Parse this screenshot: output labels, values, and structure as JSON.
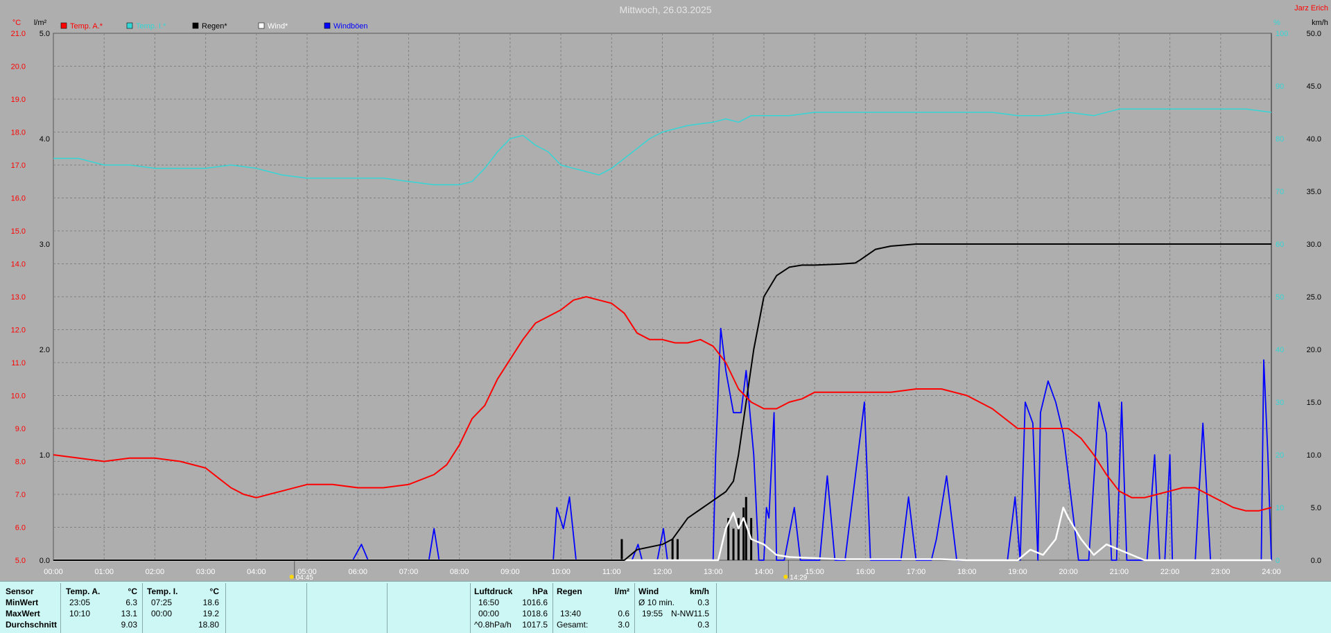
{
  "title": "Mittwoch, 26.03.2025",
  "station": "Jarz Erich",
  "colors": {
    "temp_a": "#ff0000",
    "temp_i": "#33d6d6",
    "regen": "#000000",
    "wind": "#ffffff",
    "windboeen": "#0000ff",
    "bg": "#aeaeae",
    "panel": "#ccf7f4"
  },
  "axes": {
    "temp_unit": "°C",
    "rain_unit": "l/m²",
    "humidity_unit": "%",
    "wind_unit": "km/h",
    "temp_ticks": [
      "5.0",
      "6.0",
      "7.0",
      "8.0",
      "9.0",
      "10.0",
      "11.0",
      "12.0",
      "13.0",
      "14.0",
      "15.0",
      "16.0",
      "17.0",
      "18.0",
      "19.0",
      "20.0",
      "21.0"
    ],
    "rain_ticks": [
      "0.0",
      "1.0",
      "2.0",
      "3.0",
      "4.0",
      "5.0"
    ],
    "humidity_ticks": [
      "0",
      "10",
      "20",
      "30",
      "40",
      "50",
      "60",
      "70",
      "80",
      "90",
      "100"
    ],
    "wind_ticks": [
      "0.0",
      "5.0",
      "10.0",
      "15.0",
      "20.0",
      "25.0",
      "30.0",
      "35.0",
      "40.0",
      "45.0",
      "50.0"
    ],
    "x_ticks": [
      "00:00",
      "01:00",
      "02:00",
      "03:00",
      "04:00",
      "05:00",
      "06:00",
      "07:00",
      "08:00",
      "09:00",
      "10:00",
      "11:00",
      "12:00",
      "13:00",
      "14:00",
      "15:00",
      "16:00",
      "17:00",
      "18:00",
      "19:00",
      "20:00",
      "21:00",
      "22:00",
      "23:00",
      "24:00"
    ],
    "sunrise": "04:45",
    "sunset": "14:29"
  },
  "legend": [
    {
      "label": "Temp. A.*",
      "color": "#ff0000"
    },
    {
      "label": "Temp. I.*",
      "color": "#33d6d6"
    },
    {
      "label": "Regen*",
      "color": "#000000"
    },
    {
      "label": "Wind*",
      "color": "#ffffff"
    },
    {
      "label": "Windböen",
      "color": "#0000ff"
    }
  ],
  "chart_data": {
    "type": "line",
    "title": "Mittwoch, 26.03.2025",
    "xlim": [
      0,
      24
    ],
    "ylim_temp": [
      5,
      21
    ],
    "ylim_rain": [
      0,
      5
    ],
    "ylim_wind": [
      0,
      50
    ],
    "series": [
      {
        "name": "Temp. A.*",
        "axis": "temp",
        "x": [
          0,
          0.5,
          1,
          1.5,
          2,
          2.5,
          3,
          3.25,
          3.5,
          3.75,
          4,
          4.25,
          4.5,
          5,
          5.5,
          6,
          6.5,
          7,
          7.5,
          7.75,
          8,
          8.25,
          8.5,
          8.75,
          9,
          9.25,
          9.5,
          9.75,
          10,
          10.25,
          10.5,
          10.75,
          11,
          11.25,
          11.5,
          11.75,
          12,
          12.25,
          12.5,
          12.75,
          13,
          13.25,
          13.5,
          13.75,
          14,
          14.25,
          14.5,
          14.75,
          15,
          15.5,
          16,
          16.5,
          17,
          17.5,
          18,
          18.5,
          19,
          19.5,
          20,
          20.25,
          20.5,
          20.75,
          21,
          21.25,
          21.5,
          21.75,
          22,
          22.25,
          22.5,
          22.75,
          23,
          23.25,
          23.5,
          23.75,
          24
        ],
        "y": [
          8.2,
          8.1,
          8.0,
          8.1,
          8.1,
          8.0,
          7.8,
          7.5,
          7.2,
          7.0,
          6.9,
          7.0,
          7.1,
          7.3,
          7.3,
          7.2,
          7.2,
          7.3,
          7.6,
          7.9,
          8.5,
          9.3,
          9.7,
          10.5,
          11.1,
          11.7,
          12.2,
          12.4,
          12.6,
          12.9,
          13.0,
          12.9,
          12.8,
          12.5,
          11.9,
          11.7,
          11.7,
          11.6,
          11.6,
          11.7,
          11.5,
          11.0,
          10.2,
          9.8,
          9.6,
          9.6,
          9.8,
          9.9,
          10.1,
          10.1,
          10.1,
          10.1,
          10.2,
          10.2,
          10.0,
          9.6,
          9.0,
          9.0,
          9.0,
          8.7,
          8.2,
          7.6,
          7.1,
          6.9,
          6.9,
          7.0,
          7.1,
          7.2,
          7.2,
          7.0,
          6.8,
          6.6,
          6.5,
          6.5,
          6.6
        ]
      },
      {
        "name": "Temp. I.*",
        "axis": "temp",
        "x": [
          0,
          0.5,
          1,
          1.5,
          2,
          2.5,
          3,
          3.5,
          4,
          4.5,
          5,
          5.5,
          6,
          6.5,
          7,
          7.5,
          8,
          8.25,
          8.5,
          8.75,
          9,
          9.25,
          9.5,
          9.75,
          10,
          10.25,
          10.5,
          10.75,
          11,
          11.25,
          11.5,
          11.75,
          12,
          12.5,
          13,
          13.25,
          13.5,
          13.75,
          14,
          14.5,
          15,
          15.5,
          16,
          16.5,
          17,
          17.5,
          18,
          18.5,
          19,
          19.25,
          19.5,
          20,
          20.5,
          21,
          21.5,
          22,
          22.5,
          23,
          23.5,
          24
        ],
        "y": [
          17.2,
          17.2,
          17.0,
          17.0,
          16.9,
          16.9,
          16.9,
          17.0,
          16.9,
          16.7,
          16.6,
          16.6,
          16.6,
          16.6,
          16.5,
          16.4,
          16.4,
          16.5,
          16.9,
          17.4,
          17.8,
          17.9,
          17.6,
          17.4,
          17.0,
          16.9,
          16.8,
          16.7,
          16.9,
          17.2,
          17.5,
          17.8,
          18.0,
          18.2,
          18.3,
          18.4,
          18.3,
          18.5,
          18.5,
          18.5,
          18.6,
          18.6,
          18.6,
          18.6,
          18.6,
          18.6,
          18.6,
          18.6,
          18.5,
          18.5,
          18.5,
          18.6,
          18.5,
          18.7,
          18.7,
          18.7,
          18.7,
          18.7,
          18.7,
          18.6
        ]
      },
      {
        "name": "Regen*",
        "axis": "rain",
        "x": [
          0,
          11.25,
          11.5,
          12,
          12.2,
          12.5,
          12.8,
          13.1,
          13.25,
          13.4,
          13.5,
          13.65,
          13.8,
          14,
          14.25,
          14.5,
          14.75,
          15,
          15.5,
          15.8,
          15.9,
          16.2,
          16.5,
          17,
          20,
          24
        ],
        "y": [
          0,
          0,
          0.1,
          0.15,
          0.2,
          0.4,
          0.5,
          0.6,
          0.65,
          0.75,
          1.0,
          1.5,
          2.0,
          2.5,
          2.7,
          2.78,
          2.8,
          2.8,
          2.81,
          2.82,
          2.85,
          2.95,
          2.98,
          3.0,
          3.0,
          3.0
        ]
      },
      {
        "name": "Wind*",
        "axis": "wind",
        "x": [
          0,
          13.1,
          13.25,
          13.4,
          13.5,
          13.6,
          13.75,
          14,
          14.25,
          14.5,
          15,
          15.5,
          16,
          16.5,
          17,
          17.5,
          18,
          19,
          19.25,
          19.5,
          19.75,
          19.9,
          20,
          20.25,
          20.5,
          20.75,
          21,
          21.25,
          21.5,
          22,
          22.5,
          23,
          24
        ],
        "y": [
          0,
          0,
          3,
          4.5,
          3,
          4,
          2,
          1.5,
          0.5,
          0.3,
          0.2,
          0.1,
          0.1,
          0.1,
          0.1,
          0.1,
          0,
          0,
          1,
          0.5,
          2,
          5,
          4,
          2,
          0.5,
          1.5,
          1,
          0.5,
          0,
          0,
          0,
          0,
          0
        ]
      },
      {
        "name": "Windböen",
        "axis": "wind",
        "x": [
          0,
          5.9,
          6.07,
          6.2,
          7.4,
          7.5,
          7.6,
          9.85,
          9.92,
          10.05,
          10.17,
          10.3,
          11.4,
          11.52,
          11.6,
          11.9,
          12.02,
          12.1,
          13,
          13.05,
          13.15,
          13.25,
          13.4,
          13.55,
          13.65,
          13.8,
          13.9,
          14,
          14.05,
          14.1,
          14.2,
          14.25,
          14.32,
          14.4,
          14.6,
          14.72,
          14.8,
          15.1,
          15.25,
          15.4,
          15.6,
          15.98,
          16.1,
          16.7,
          16.85,
          17,
          17.3,
          17.4,
          17.6,
          17.8,
          18.8,
          18.95,
          19.05,
          19.15,
          19.3,
          19.4,
          19.45,
          19.6,
          19.75,
          19.9,
          20,
          20.2,
          20.3,
          20.4,
          20.6,
          20.75,
          20.85,
          20.95,
          21.05,
          21.15,
          21.3,
          21.55,
          21.7,
          21.8,
          21.9,
          22,
          22.05,
          22.2,
          22.5,
          22.65,
          22.8,
          23.8,
          23.85,
          23.93,
          24
        ],
        "y": [
          0,
          0,
          1.5,
          0,
          0,
          3,
          0,
          0,
          5,
          3,
          6,
          0,
          0,
          1.5,
          0,
          0,
          3,
          0,
          0,
          10,
          22,
          18,
          14,
          14,
          18,
          10,
          0,
          0,
          5,
          4,
          14,
          0,
          0,
          0,
          5,
          0,
          0,
          0,
          8,
          0,
          0,
          15,
          0,
          0,
          6,
          0,
          0,
          2,
          8,
          0,
          0,
          6,
          0,
          15,
          13,
          0,
          14,
          17,
          15,
          12,
          8,
          0,
          0,
          0,
          15,
          12,
          0,
          0,
          15,
          0,
          0,
          0,
          10,
          0,
          0,
          10,
          0,
          0,
          0,
          13,
          0,
          0,
          19,
          10,
          0
        ]
      }
    ],
    "rain_bars": {
      "x": [
        11.2,
        12.2,
        12.3,
        13.3,
        13.4,
        13.5,
        13.6,
        13.65,
        13.75
      ],
      "y": [
        0.2,
        0.2,
        0.2,
        0.4,
        0.3,
        0.4,
        0.5,
        0.6,
        0.4
      ]
    }
  },
  "stats": {
    "sensor_label": "Sensor",
    "min_label": "MinWert",
    "max_label": "MaxWert",
    "avg_label": "Durchschnitt",
    "temp_a": {
      "title": "Temp. A.",
      "unit": "°C",
      "min_time": "23:05",
      "min_val": "6.3",
      "max_time": "10:10",
      "max_val": "13.1",
      "avg": "9.03"
    },
    "temp_i": {
      "title": "Temp. I.",
      "unit": "°C",
      "min_time": "07:25",
      "min_val": "18.6",
      "max_time": "00:00",
      "max_val": "19.2",
      "avg": "18.80"
    },
    "luftdruck": {
      "title": "Luftdruck",
      "unit": "hPa",
      "min_time": "16:50",
      "min_val": "1016.6",
      "max_time": "00:00",
      "max_val": "1018.6",
      "avg_label": "^0.8hPa/h",
      "avg": "1017.5"
    },
    "regen": {
      "title": "Regen",
      "unit": "l/m²",
      "max_time": "13:40",
      "max_val": "0.6",
      "total_label": "Gesamt:",
      "total": "3.0"
    },
    "wind": {
      "title": "Wind",
      "unit": "km/h",
      "min_label": "Ø 10 min.",
      "min_val": "0.3",
      "max_time": "19:55",
      "max_dir": "N-NW",
      "max_val": "11.5",
      "avg": "0.3"
    }
  }
}
